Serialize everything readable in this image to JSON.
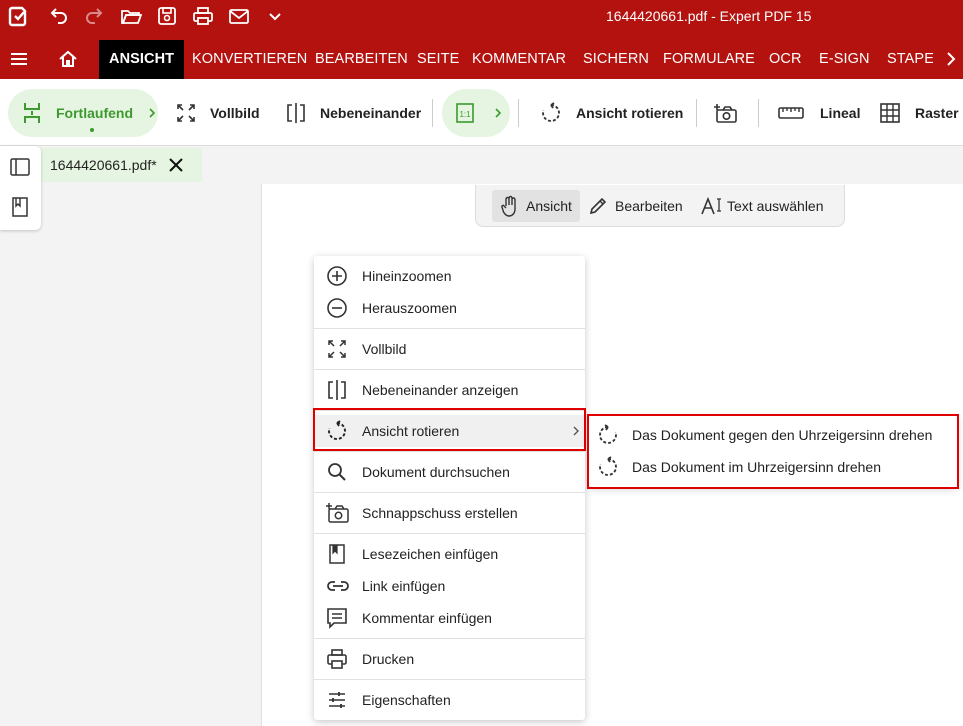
{
  "titlebar": {
    "title": "1644420661.pdf - Expert PDF 15",
    "icons": [
      "app-logo-icon",
      "undo-icon",
      "redo-icon",
      "open-folder-icon",
      "save-icon",
      "print-icon",
      "mail-icon",
      "chevron-down-icon"
    ]
  },
  "menubar": {
    "tabs": [
      "ANSICHT",
      "KONVERTIEREN",
      "BEARBEITEN",
      "SEITE",
      "KOMMENTAR",
      "SICHERN",
      "FORMULARE",
      "OCR",
      "E-SIGN",
      "STAPEL"
    ],
    "active": "ANSICHT"
  },
  "ribbon": {
    "continuous": "Fortlaufend",
    "fullscreen": "Vollbild",
    "side_by_side": "Nebeneinander",
    "rotate_view": "Ansicht rotieren",
    "ruler": "Lineal",
    "grid": "Raster"
  },
  "document_tab": {
    "name": "1644420661.pdf*"
  },
  "mode_bar": {
    "view": "Ansicht",
    "edit": "Bearbeiten",
    "select_text": "Text auswählen"
  },
  "context_menu": {
    "items": [
      {
        "label": "Hineinzoomen",
        "icon": "zoom-in-icon"
      },
      {
        "label": "Herauszoomen",
        "icon": "zoom-out-icon"
      },
      {
        "label": "Vollbild",
        "icon": "fullscreen-icon"
      },
      {
        "label": "Nebeneinander anzeigen",
        "icon": "side-by-side-icon"
      },
      {
        "label": "Ansicht rotieren",
        "icon": "rotate-icon"
      },
      {
        "label": "Dokument durchsuchen",
        "icon": "search-icon"
      },
      {
        "label": "Schnappschuss erstellen",
        "icon": "snapshot-icon"
      },
      {
        "label": "Lesezeichen einfügen",
        "icon": "bookmark-icon"
      },
      {
        "label": "Link einfügen",
        "icon": "link-icon"
      },
      {
        "label": "Kommentar einfügen",
        "icon": "comment-icon"
      },
      {
        "label": "Drucken",
        "icon": "print-icon"
      },
      {
        "label": "Eigenschaften",
        "icon": "properties-icon"
      }
    ]
  },
  "submenu": {
    "items": [
      {
        "label": "Das Dokument gegen den Uhrzeigersinn drehen",
        "icon": "rotate-ccw-icon"
      },
      {
        "label": "Das Dokument im Uhrzeigersinn drehen",
        "icon": "rotate-cw-icon"
      }
    ]
  },
  "colors": {
    "brand_red": "#b3120f",
    "active_tab": "#000000",
    "green_accent": "#3d9a2e",
    "green_bg": "#e6f5e1",
    "highlight": "#e00000"
  }
}
